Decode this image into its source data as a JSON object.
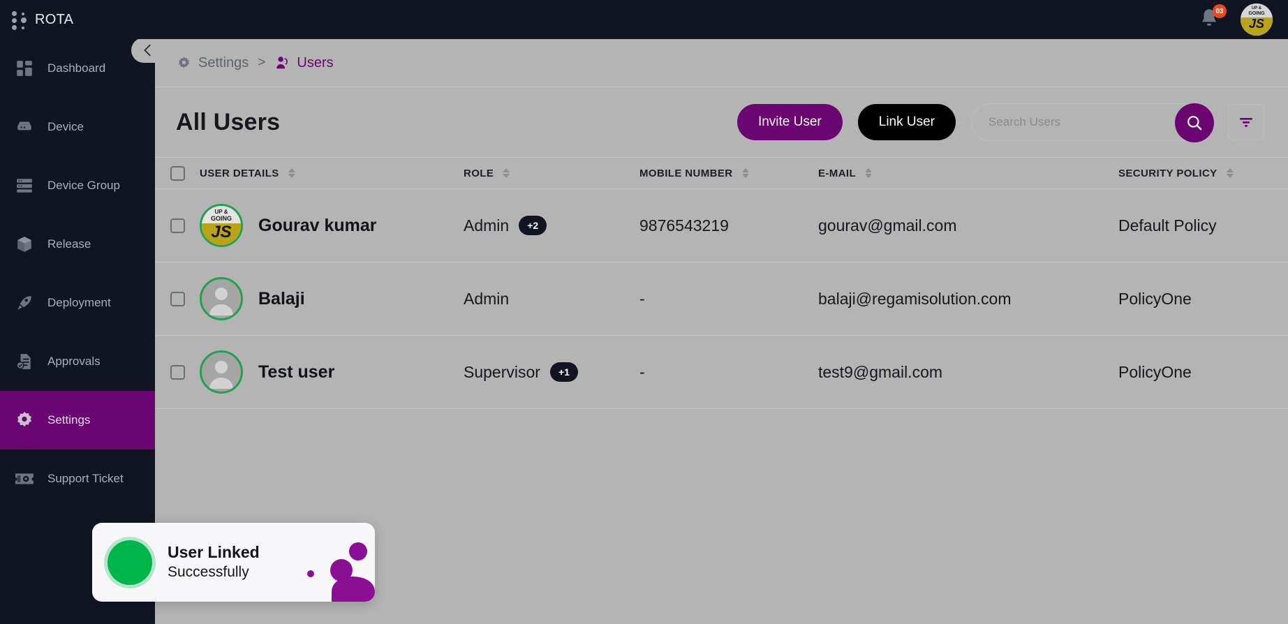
{
  "app": {
    "brand": "ROTA",
    "logo_icon": "dot-grid-icon",
    "accent_purple": "#6a0572",
    "sidebar_bg": "#111522",
    "content_bg": "#b4b4b4",
    "success_green": "#00b64a"
  },
  "topbar": {
    "notifications_icon": "bell-icon",
    "notifications_count": "03",
    "avatar_icon": "user-avatar",
    "avatar_line1": "UP &",
    "avatar_line2": "GOING",
    "avatar_initials": "JS"
  },
  "sidebar": {
    "collapse_icon": "chevron-left-icon",
    "items": [
      {
        "label": "Dashboard",
        "icon": "dashboard-icon",
        "active": false
      },
      {
        "label": "Device",
        "icon": "device-icon",
        "active": false
      },
      {
        "label": "Device Group",
        "icon": "device-group-icon",
        "active": false
      },
      {
        "label": "Release",
        "icon": "release-box-icon",
        "active": false
      },
      {
        "label": "Deployment",
        "icon": "rocket-icon",
        "active": false
      },
      {
        "label": "Approvals",
        "icon": "approvals-icon",
        "active": false
      },
      {
        "label": "Settings",
        "icon": "gear-icon",
        "active": true
      },
      {
        "label": "Support Ticket",
        "icon": "ticket-icon",
        "active": false
      }
    ]
  },
  "breadcrumb": {
    "root_icon": "gear-icon",
    "root": "Settings",
    "separator": ">",
    "current_icon": "users-icon",
    "current": "Users"
  },
  "page": {
    "title": "All Users",
    "invite_label": "Invite User",
    "link_label": "Link User",
    "search_placeholder": "Search Users",
    "search_value": "",
    "search_icon": "search-icon",
    "filter_icon": "filter-icon"
  },
  "table": {
    "select_all_checked": false,
    "columns": [
      {
        "label": "USER DETAILS",
        "sortable": true
      },
      {
        "label": "ROLE",
        "sortable": true
      },
      {
        "label": "MOBILE NUMBER",
        "sortable": true
      },
      {
        "label": "E-MAIL",
        "sortable": true
      },
      {
        "label": "SECURITY POLICY",
        "sortable": true
      }
    ],
    "rows": [
      {
        "checked": false,
        "avatar_type": "photo",
        "avatar_line1": "UP &",
        "avatar_line2": "GOING",
        "avatar_initials": "JS",
        "name": "Gourav kumar",
        "role": "Admin",
        "role_extra": "+2",
        "mobile": "9876543219",
        "email": "gourav@gmail.com",
        "policy": "Default Policy"
      },
      {
        "checked": false,
        "avatar_type": "placeholder",
        "name": "Balaji",
        "role": "Admin",
        "role_extra": "",
        "mobile": "-",
        "email": "balaji@regamisolution.com",
        "policy": "PolicyOne"
      },
      {
        "checked": false,
        "avatar_type": "placeholder",
        "name": "Test user",
        "role": "Supervisor",
        "role_extra": "+1",
        "mobile": "-",
        "email": "test9@gmail.com",
        "policy": "PolicyOne"
      }
    ]
  },
  "toast": {
    "status_icon": "success-circle-icon",
    "title": "User Linked",
    "subtitle": "Successfully"
  }
}
